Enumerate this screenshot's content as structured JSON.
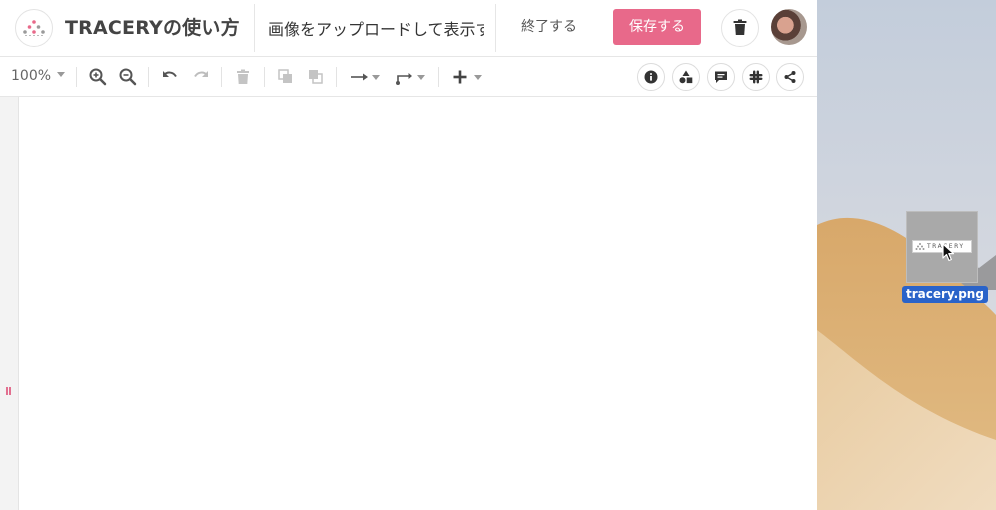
{
  "header": {
    "app_title": "TRACERYの使い方",
    "document_title": "画像をアップロードして表示す",
    "finish_label": "終了する",
    "save_label": "保存する"
  },
  "toolbar": {
    "zoom_value": "100%",
    "icons": [
      "zoom-in-icon",
      "zoom-out-icon",
      "undo-icon",
      "redo-icon",
      "delete-icon",
      "bring-to-front-icon",
      "send-to-back-icon",
      "arrow-style-icon",
      "connector-style-icon",
      "add-icon",
      "info-icon",
      "shapes-icon",
      "comment-icon",
      "slack-icon",
      "share-icon"
    ]
  },
  "desktop": {
    "file_name": "tracery.png",
    "thumbnail_text": "TRACERY"
  },
  "colors": {
    "accent": "#e8698a",
    "file_label_bg": "#2a63c9"
  }
}
